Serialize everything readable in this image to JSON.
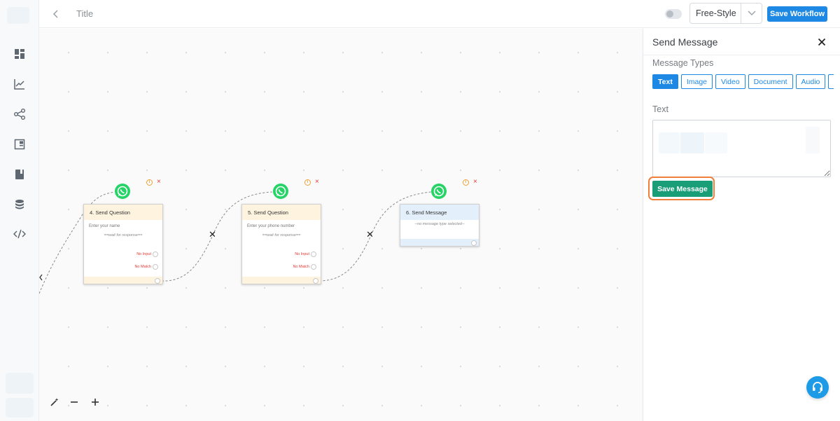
{
  "colors": {
    "accent": "#1e88e5",
    "save_message_bg": "#1a9e78",
    "whatsapp": "#25d366",
    "error": "#e53935",
    "highlight_ring": "#f07f3c"
  },
  "sidebar": {
    "icons": [
      "dashboard-icon",
      "analytics-chart-icon",
      "workflow-share-icon",
      "layout-panel-icon",
      "book-icon",
      "database-icon",
      "code-icon"
    ]
  },
  "header": {
    "title": "Title",
    "mode_select": {
      "value": "Free-Style"
    },
    "save_workflow_label": "Save Workflow"
  },
  "canvas": {
    "nodes": [
      {
        "title": "4. Send Question",
        "placeholder": "Enter your name",
        "wait_text": "==wait for response==",
        "ports": [
          "No Input",
          "No Match"
        ]
      },
      {
        "title": "5. Send Question",
        "placeholder": "Enter your phone number",
        "wait_text": "==wait for response==",
        "ports": [
          "No Input",
          "No Match"
        ]
      },
      {
        "title": "6. Send Message",
        "message_text": "--no message type selected--"
      }
    ],
    "info_glyph": "i",
    "remove_glyph": "×"
  },
  "panel": {
    "title": "Send Message",
    "message_types_label": "Message Types",
    "message_types": [
      "Text",
      "Image",
      "Video",
      "Document",
      "Audio"
    ],
    "active_type": "Text",
    "text_label": "Text",
    "save_message_label": "Save Message"
  }
}
